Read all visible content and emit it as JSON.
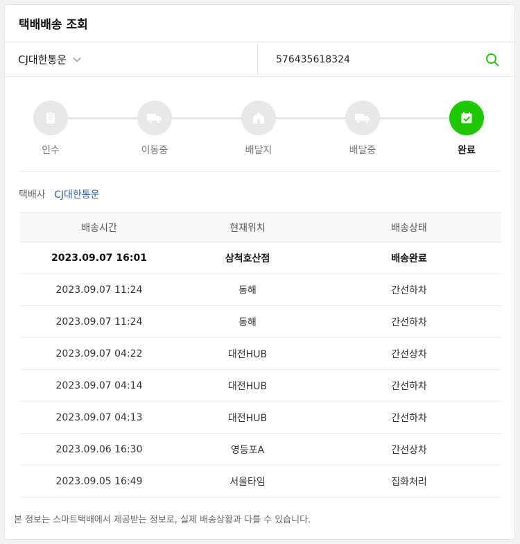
{
  "title": "택배배송 조회",
  "search": {
    "carrier": "CJ대한통운",
    "tracking_number": "576435618324"
  },
  "steps": [
    {
      "label": "인수",
      "icon": "receipt-icon",
      "active": false
    },
    {
      "label": "이동중",
      "icon": "truck-icon",
      "active": false
    },
    {
      "label": "배달지",
      "icon": "home-icon",
      "active": false
    },
    {
      "label": "배달중",
      "icon": "truck-icon",
      "active": false
    },
    {
      "label": "완료",
      "icon": "calendar-check-icon",
      "active": true
    }
  ],
  "carrier_info": {
    "label": "택배사",
    "value": "CJ대한통운"
  },
  "table": {
    "headers": [
      "배송시간",
      "현재위치",
      "배송상태"
    ],
    "rows": [
      [
        "2023.09.07 16:01",
        "삼척호산점",
        "배송완료"
      ],
      [
        "2023.09.07 11:24",
        "동해",
        "간선하차"
      ],
      [
        "2023.09.07 11:24",
        "동해",
        "간선하차"
      ],
      [
        "2023.09.07 04:22",
        "대전HUB",
        "간선상차"
      ],
      [
        "2023.09.07 04:14",
        "대전HUB",
        "간선하차"
      ],
      [
        "2023.09.07 04:13",
        "대전HUB",
        "간선하차"
      ],
      [
        "2023.09.06 16:30",
        "영등포A",
        "간선상차"
      ],
      [
        "2023.09.05 16:49",
        "서울타임",
        "집화처리"
      ]
    ]
  },
  "notice": "본 정보는 스마트택배에서 제공받는 정보로, 실제 배송상황과 다를 수 있습니다.",
  "colors": {
    "accent": "#1ec800",
    "carrier_link": "#2e5fa8",
    "inactive_step": "#e8e8e8"
  }
}
